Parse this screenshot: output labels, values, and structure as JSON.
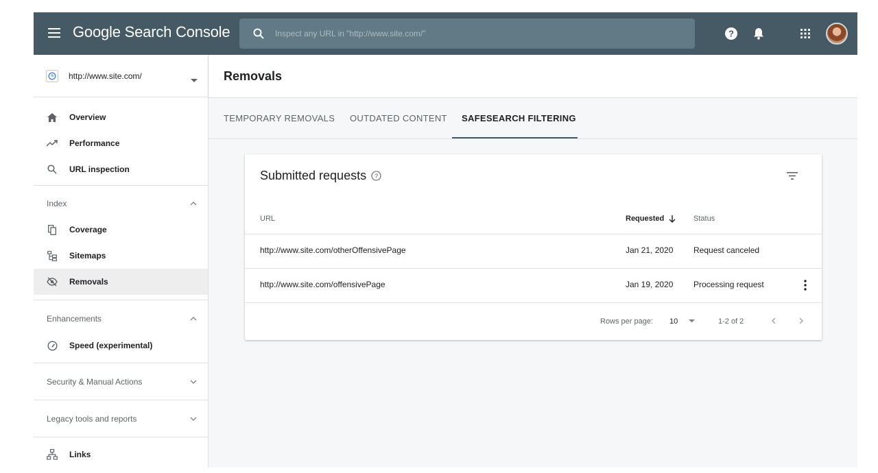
{
  "app": {
    "title": "Google Search Console",
    "search_placeholder": "Inspect any URL in \"http://www.site.com/\""
  },
  "property": {
    "label": "http://www.site.com/"
  },
  "sidebar": {
    "top_items": [
      {
        "label": "Overview",
        "icon": "home-icon"
      },
      {
        "label": "Performance",
        "icon": "trending-icon"
      },
      {
        "label": "URL inspection",
        "icon": "search-icon"
      }
    ],
    "index": {
      "label": "Index",
      "items": [
        {
          "label": "Coverage",
          "icon": "coverage-icon"
        },
        {
          "label": "Sitemaps",
          "icon": "sitemap-icon"
        },
        {
          "label": "Removals",
          "icon": "removals-icon",
          "active": true
        }
      ]
    },
    "enhancements": {
      "label": "Enhancements",
      "items": [
        {
          "label": "Speed (experimental)",
          "icon": "speed-icon"
        }
      ]
    },
    "security": {
      "label": "Security & Manual Actions"
    },
    "legacy": {
      "label": "Legacy tools and reports"
    },
    "links": {
      "label": "Links",
      "icon": "links-icon"
    }
  },
  "page": {
    "title": "Removals",
    "tabs": [
      {
        "label": "TEMPORARY REMOVALS",
        "active": false
      },
      {
        "label": "OUTDATED CONTENT",
        "active": false
      },
      {
        "label": "SAFESEARCH FILTERING",
        "active": true
      }
    ]
  },
  "card": {
    "title": "Submitted requests",
    "columns": {
      "url": "URL",
      "requested": "Requested",
      "status": "Status"
    },
    "rows": [
      {
        "url": "http://www.site.com/otherOffensivePage",
        "requested": "Jan 21, 2020",
        "status": "Request canceled"
      },
      {
        "url": "http://www.site.com/offensivePage",
        "requested": "Jan 19, 2020",
        "status": "Processing request"
      }
    ],
    "pagination": {
      "rows_per_page_label": "Rows per page:",
      "rows_per_page_value": "10",
      "range": "1-2 of 2"
    }
  },
  "colors": {
    "topbar": "#455a64",
    "search_bg": "#617a85",
    "active_nav_bg": "#eeeeee"
  }
}
